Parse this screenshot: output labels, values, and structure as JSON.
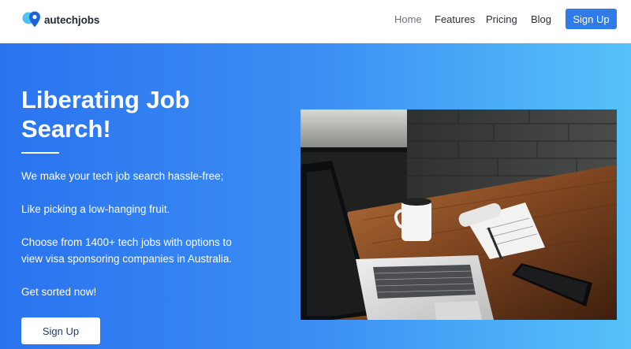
{
  "brand": {
    "name": "autechjobs"
  },
  "nav": {
    "home": "Home",
    "features": "Features",
    "pricing": "Pricing",
    "blog": "Blog",
    "signup": "Sign Up"
  },
  "hero": {
    "title": "Liberating Job Search!",
    "paragraphs": [
      "We make your tech job search hassle-free;",
      "Like picking a low-hanging fruit.",
      "Choose from 1400+ tech jobs with options to view visa sponsoring companies in Australia.",
      "Get sorted now!"
    ],
    "cta": "Sign Up"
  },
  "colors": {
    "accent": "#2f7be8",
    "hero_gradient_start": "#2a73ef",
    "hero_gradient_end": "#56c2f9"
  },
  "icons": {
    "logo": "location-pin-logo-icon"
  }
}
